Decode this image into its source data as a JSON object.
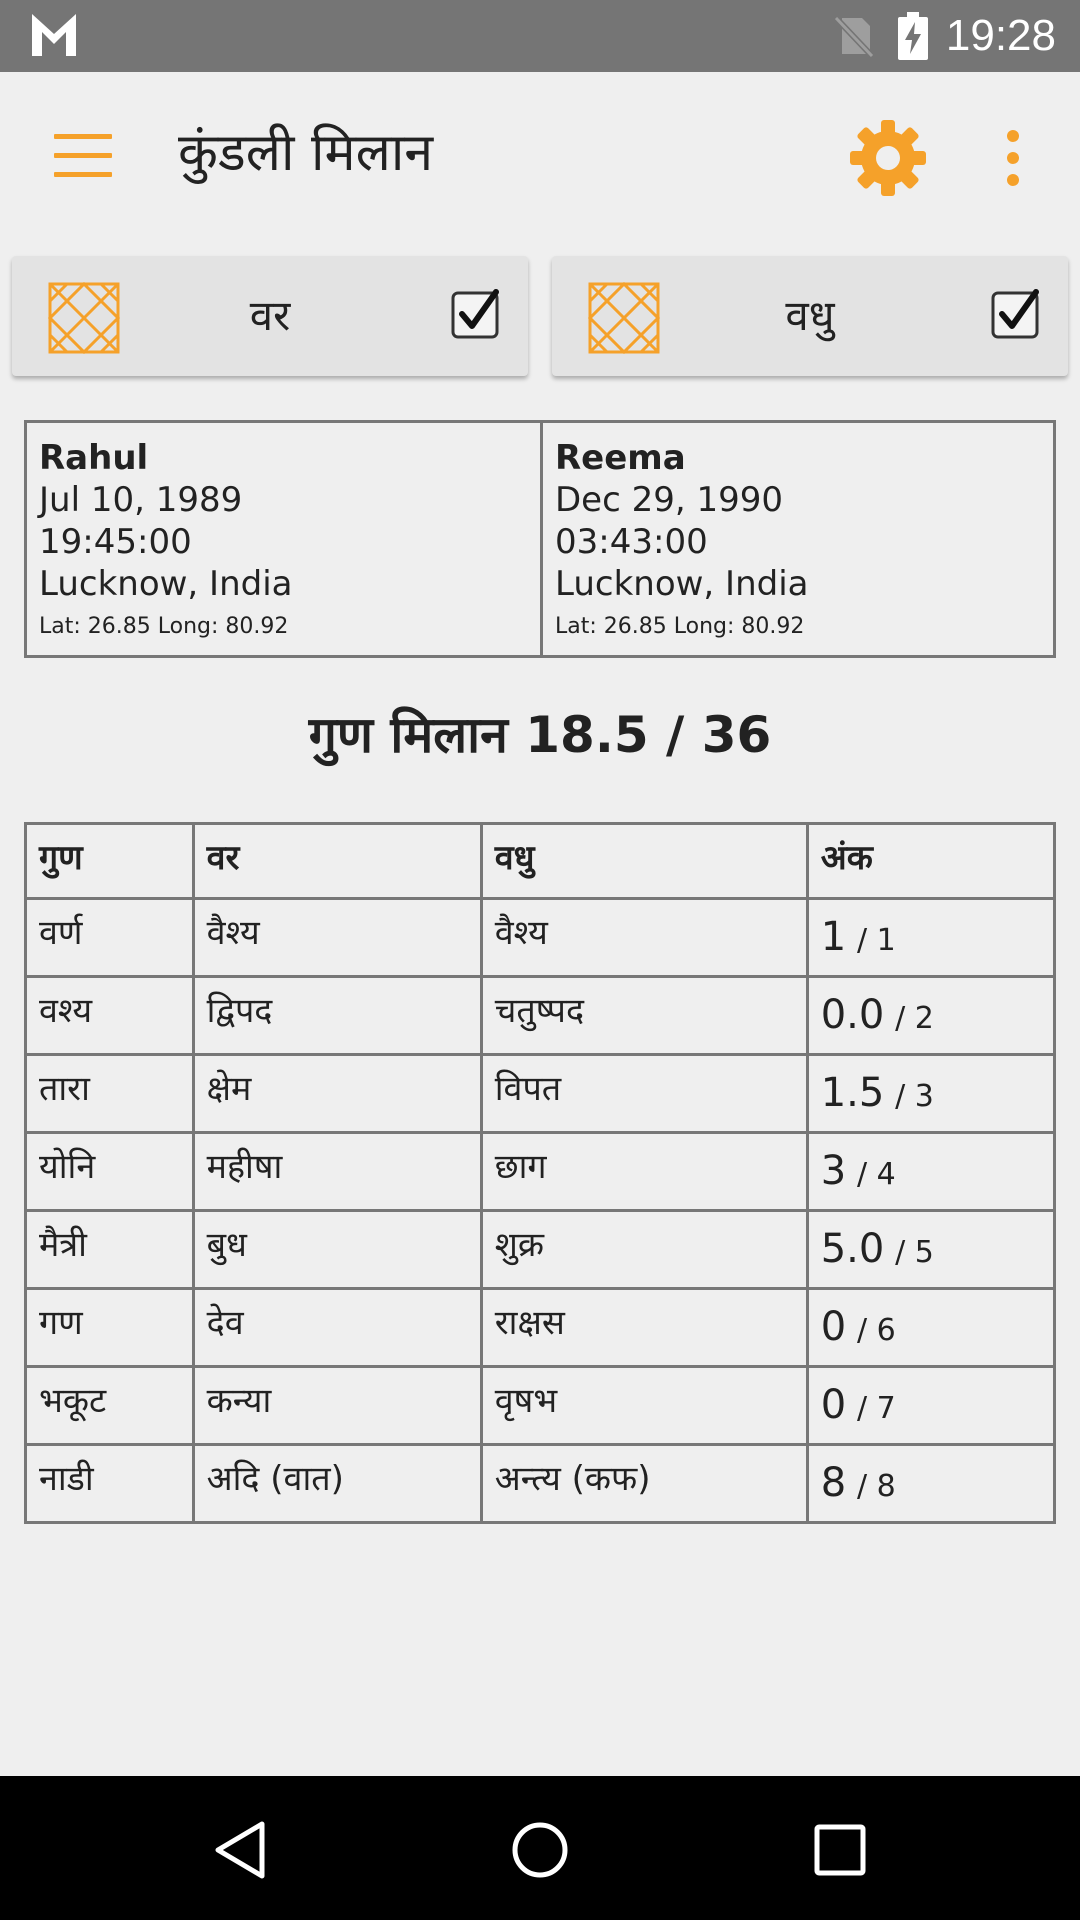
{
  "status_bar": {
    "time": "19:28",
    "icons": [
      "gmail-icon",
      "no-sim-icon",
      "battery-charging-icon"
    ]
  },
  "app_bar": {
    "title": "कुंडली मिलान",
    "menu_icon": "hamburger-menu-icon",
    "settings_icon": "gear-icon",
    "overflow_icon": "more-vert-icon",
    "accent_color": "#f5a12a"
  },
  "profiles": {
    "groom_label": "वर",
    "bride_label": "वधु",
    "groom_checked": true,
    "bride_checked": true
  },
  "groom": {
    "name": "Rahul",
    "date": "Jul 10, 1989",
    "time": "19:45:00",
    "place": "Lucknow, India",
    "coords": "Lat: 26.85 Long: 80.92"
  },
  "bride": {
    "name": "Reema",
    "date": "Dec 29, 1990",
    "time": "03:43:00",
    "place": "Lucknow, India",
    "coords": "Lat: 26.85 Long: 80.92"
  },
  "guna_milan": {
    "heading": "गुण मिलान 18.5 / 36",
    "headers": [
      "गुण",
      "वर",
      "वधु",
      "अंक"
    ],
    "rows": [
      {
        "guna": "वर्ण",
        "var": "वैश्य",
        "vadhu": "वैश्य",
        "score": "1",
        "max": "/ 1"
      },
      {
        "guna": "वश्य",
        "var": "द्विपद",
        "vadhu": "चतुष्पद",
        "score": "0.0",
        "max": "/ 2"
      },
      {
        "guna": "तारा",
        "var": "क्षेम",
        "vadhu": "विपत",
        "score": "1.5",
        "max": "/ 3"
      },
      {
        "guna": "योनि",
        "var": "महीषा",
        "vadhu": "छाग",
        "score": "3",
        "max": "/ 4"
      },
      {
        "guna": "मैत्री",
        "var": "बुध",
        "vadhu": "शुक्र",
        "score": "5.0",
        "max": "/ 5"
      },
      {
        "guna": "गण",
        "var": "देव",
        "vadhu": "राक्षस",
        "score": "0",
        "max": "/ 6"
      },
      {
        "guna": "भकूट",
        "var": "कन्या",
        "vadhu": "वृषभ",
        "score": "0",
        "max": "/ 7"
      },
      {
        "guna": "नाडी",
        "var": "अदि (वात)",
        "vadhu": "अन्त्य (कफ)",
        "score": "8",
        "max": "/ 8"
      }
    ]
  },
  "nav_bar": {
    "icons": [
      "back-icon",
      "home-icon",
      "recents-icon"
    ]
  }
}
